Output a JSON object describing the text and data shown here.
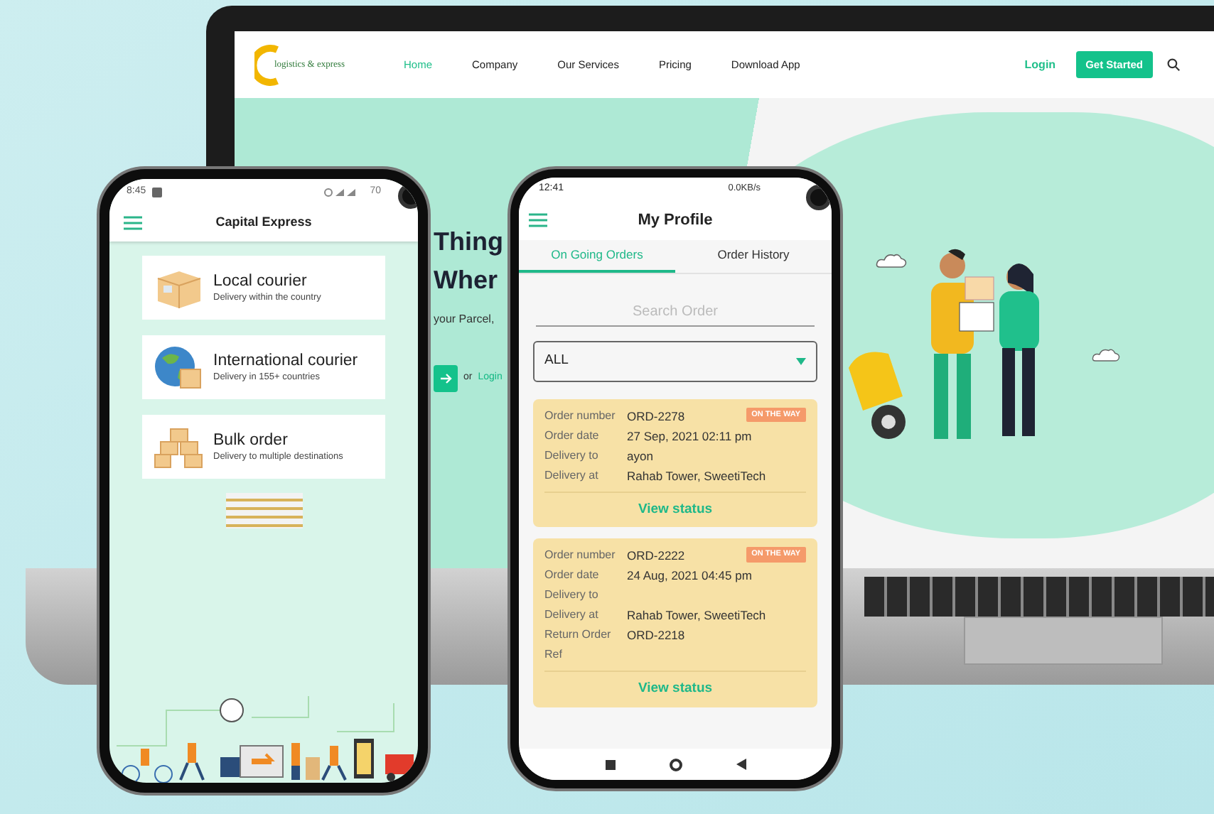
{
  "website": {
    "logo_text": "logistics & express",
    "nav": [
      {
        "label": "Home",
        "selected": true
      },
      {
        "label": "Company",
        "selected": false
      },
      {
        "label": "Our Services",
        "selected": false
      },
      {
        "label": "Pricing",
        "selected": false
      },
      {
        "label": "Download App",
        "selected": false
      }
    ],
    "login": "Login",
    "cta": "Get Started",
    "hero": {
      "heading_lines": [
        "Thing",
        "Wher"
      ],
      "subtitle": "your Parcel,",
      "or": "or",
      "login_link": "Login"
    }
  },
  "left_phone": {
    "status_time": "8:45",
    "battery": "70",
    "title": "Capital Express",
    "services": [
      {
        "kind": "box",
        "title": "Local courier",
        "subtitle": "Delivery within the country"
      },
      {
        "kind": "globe",
        "title": "International courier",
        "subtitle": "Delivery in 155+ countries"
      },
      {
        "kind": "boxes",
        "title": "Bulk order",
        "subtitle": "Delivery to multiple destinations"
      }
    ]
  },
  "right_phone": {
    "status_time": "12:41",
    "net_speed": "0.0KB/s",
    "title": "My Profile",
    "tabs": [
      {
        "label": "On Going Orders",
        "selected": true
      },
      {
        "label": "Order History",
        "selected": false
      }
    ],
    "search_placeholder": "Search Order",
    "filter": "ALL",
    "orders": [
      {
        "badge": "ON THE WAY",
        "action": "View status",
        "fields": [
          {
            "label": "Order number",
            "value": "ORD-2278"
          },
          {
            "label": "Order date",
            "value": "27 Sep, 2021 02:11 pm"
          },
          {
            "label": "Delivery to",
            "value": "ayon"
          },
          {
            "label": "Delivery at",
            "value": "Rahab Tower, SweetiTech"
          }
        ]
      },
      {
        "badge": "ON THE WAY",
        "action": "View status",
        "fields": [
          {
            "label": "Order number",
            "value": "ORD-2222"
          },
          {
            "label": "Order date",
            "value": "24 Aug, 2021 04:45 pm"
          },
          {
            "label": "Delivery to"
          },
          {
            "label": "Delivery at",
            "value": "Rahab Tower, SweetiTech"
          },
          {
            "label": "Return Order Ref",
            "value": "ORD-2218"
          }
        ]
      }
    ]
  }
}
